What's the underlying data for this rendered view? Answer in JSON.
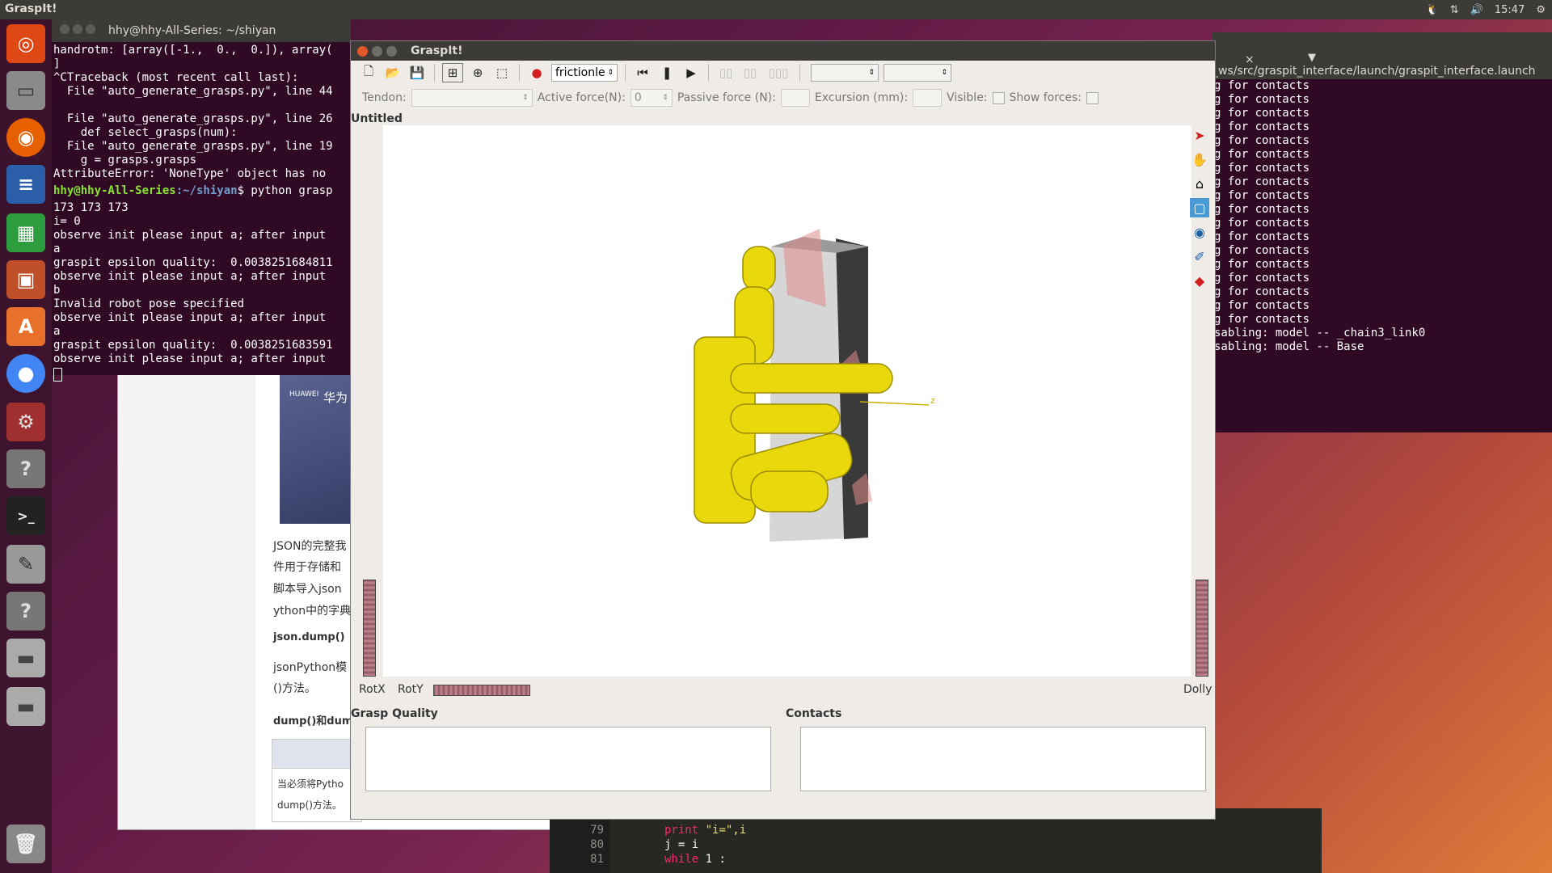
{
  "top_panel": {
    "app_name": "GraspIt!",
    "time": "15:47"
  },
  "terminal_left": {
    "title": "hhy@hhy-All-Series: ~/shiyan",
    "lines": [
      "handrotm: [array([-1.,  0.,  0.]), array(",
      "]",
      "^CTraceback (most recent call last):",
      "  File \"auto_generate_grasps.py\", line 44",
      "",
      "  File \"auto_generate_grasps.py\", line 26",
      "    def select_grasps(num):",
      "  File \"auto_generate_grasps.py\", line 19",
      "    g = grasps.grasps",
      "AttributeError: 'NoneType' object has no"
    ],
    "prompt_user": "hhy@hhy-All-Series",
    "prompt_path": ":~/shiyan",
    "prompt_cmd": "$ python grasp",
    "lines_after": [
      "173 173 173",
      "i= 0",
      "observe init please input a; after input",
      "a",
      "graspit epsilon quality:  0.0038251684811",
      "observe init please input a; after input",
      "b",
      "Invalid robot pose specified",
      "observe init please input a; after input",
      "a",
      "graspit epsilon quality:  0.0038251683591",
      "observe init please input a; after input"
    ]
  },
  "terminal_right": {
    "tab_path": "_ws/src/graspit_interface/launch/graspit_interface.launch",
    "lines": [
      "g for contacts",
      "g for contacts",
      "g for contacts",
      "g for contacts",
      "g for contacts",
      "g for contacts",
      "g for contacts",
      "g for contacts",
      "g for contacts",
      "g for contacts",
      "g for contacts",
      "g for contacts",
      "g for contacts",
      "g for contacts",
      "g for contacts",
      "g for contacts",
      "g for contacts",
      "g for contacts",
      "sabling: model -- _chain3_link0",
      "sabling: model -- Base"
    ]
  },
  "browser": {
    "banner_text": "华为",
    "banner_brand": "HUAWEI",
    "para": [
      "JSON的完整我",
      "件用于存储和",
      "脚本导入json",
      "ython中的字典"
    ],
    "h1": "json.dump()",
    "p2_a": "jsonPython模",
    "p2_b": "()方法。",
    "h2": "dump()和dump",
    "table_cell_a": "当必须将Pytho",
    "table_cell_b": "dump()方法。"
  },
  "editor": {
    "line_numbers": [
      "79",
      "80",
      "81"
    ],
    "code": [
      {
        "kw": "print",
        "rest": " \"i=\",i"
      },
      {
        "kw": "",
        "rest": "j = i"
      },
      {
        "kw": "while",
        "rest": " 1 :"
      }
    ]
  },
  "graspit": {
    "title": "GraspIt!",
    "document_title": "Untitled",
    "material_select": "frictionle",
    "tendon_label": "Tendon:",
    "active_force_label": "Active force(N):",
    "active_force_value": "0",
    "passive_force_label": "Passive force (N):",
    "excursion_label": "Excursion (mm):",
    "visible_label": "Visible:",
    "show_forces_label": "Show forces:",
    "rotx_label": "RotX",
    "roty_label": "RotY",
    "dolly_label": "Dolly",
    "grasp_quality_label": "Grasp Quality",
    "contacts_label": "Contacts",
    "axis_label": "z"
  },
  "colors": {
    "hand_yellow": "#e8d80c",
    "terminal_bg": "#300a24",
    "panel_bg": "#3c3b37"
  }
}
